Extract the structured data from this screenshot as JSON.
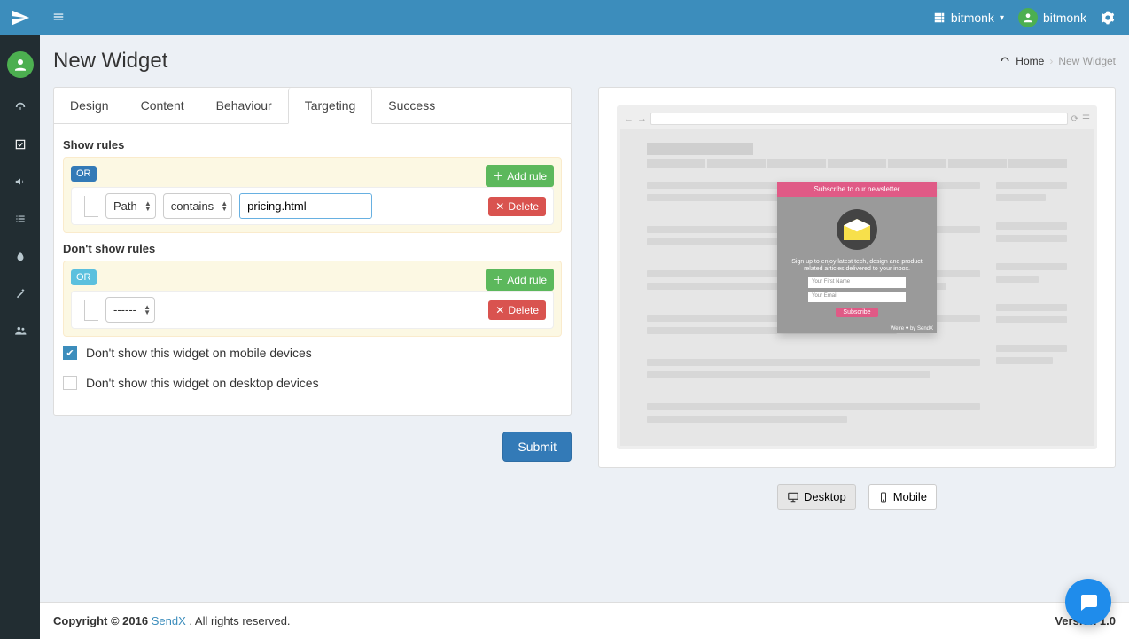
{
  "header": {
    "org_name": "bitmonk",
    "user_name": "bitmonk"
  },
  "page": {
    "title": "New Widget",
    "breadcrumb_home": "Home",
    "breadcrumb_current": "New Widget"
  },
  "tabs": {
    "design": "Design",
    "content": "Content",
    "behaviour": "Behaviour",
    "targeting": "Targeting",
    "success": "Success",
    "active": "targeting"
  },
  "targeting": {
    "show_label": "Show rules",
    "dont_show_label": "Don't show rules",
    "or_badge": "OR",
    "add_rule": "Add rule",
    "delete": "Delete",
    "path_select": "Path",
    "contains_select": "contains",
    "value_input": "pricing.html",
    "empty_select": "------",
    "mobile_checkbox_label": "Don't show this widget on mobile devices",
    "desktop_checkbox_label": "Don't show this widget on desktop devices",
    "mobile_checked": true,
    "desktop_checked": false,
    "submit": "Submit"
  },
  "preview": {
    "desktop_btn": "Desktop",
    "mobile_btn": "Mobile",
    "popup_title": "Subscribe to our newsletter",
    "popup_text": "Sign up to enjoy latest tech, design and product related articles delivered to your inbox.",
    "popup_name_ph": "Your First Name",
    "popup_email_ph": "Your Email",
    "popup_subscribe": "Subscribe",
    "popup_footer": "We're ♥ by SendX"
  },
  "footer": {
    "copyright_prefix": "Copyright © 2016 ",
    "brand": "SendX",
    "copyright_suffix": " . All rights reserved.",
    "version_label": "Version 1.0"
  }
}
